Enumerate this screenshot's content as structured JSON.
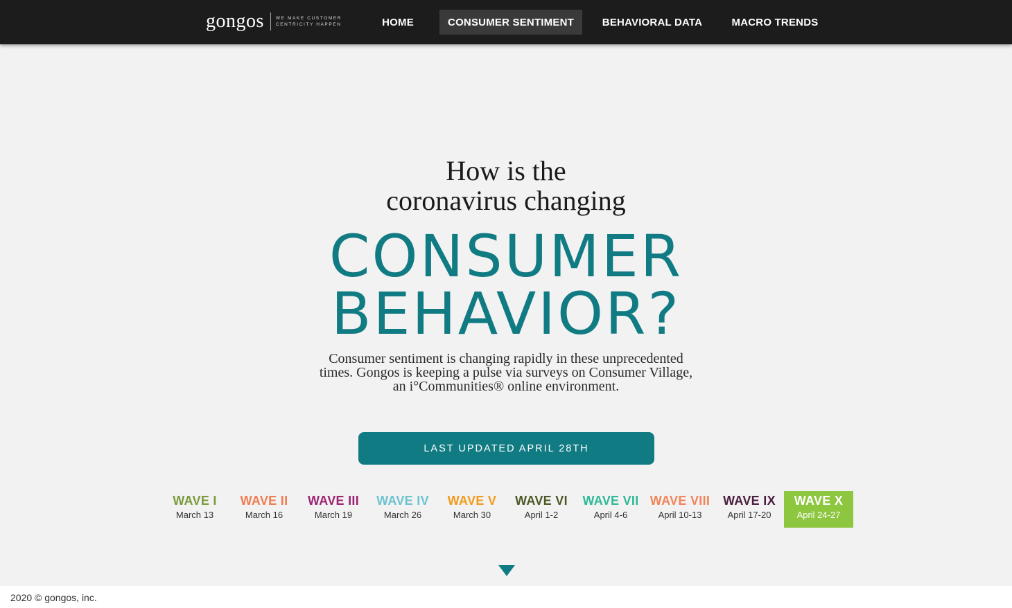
{
  "nav": {
    "logo_text": "gongos",
    "tagline_line1": "WE MAKE CUSTOMER",
    "tagline_line2": "CENTRICITY HAPPEN",
    "items": [
      {
        "label": "HOME"
      },
      {
        "label": "CONSUMER SENTIMENT"
      },
      {
        "label": "BEHAVIORAL DATA"
      },
      {
        "label": "MACRO TRENDS"
      }
    ],
    "active": "CONSUMER SENTIMENT"
  },
  "hero": {
    "line1": "How is the",
    "line2": "coronavirus changing",
    "big1": "CONSUMER",
    "big2": "BEHAVIOR?",
    "desc_line1": "Consumer sentiment is changing rapidly in these unprecedented",
    "desc_line2": "times. Gongos is keeping a pulse via surveys on Consumer Village,",
    "desc_line3": "an i°Communities® online environment.",
    "button_label": "LAST UPDATED APRIL 28TH"
  },
  "waves": [
    {
      "title": "WAVE I",
      "date": "March 13",
      "color": "#7a9a3a"
    },
    {
      "title": "WAVE II",
      "date": "March 16",
      "color": "#f07c52"
    },
    {
      "title": "WAVE III",
      "date": "March 19",
      "color": "#9c2473"
    },
    {
      "title": "WAVE IV",
      "date": "March 26",
      "color": "#6cc3cf"
    },
    {
      "title": "WAVE V",
      "date": "March 30",
      "color": "#f39a1b"
    },
    {
      "title": "WAVE VI",
      "date": "April 1-2",
      "color": "#4d5a26"
    },
    {
      "title": "WAVE VII",
      "date": "April 4-6",
      "color": "#2fb89a"
    },
    {
      "title": "WAVE VIII",
      "date": "April 10-13",
      "color": "#f2845c"
    },
    {
      "title": "WAVE IX",
      "date": "April 17-20",
      "color": "#4a2040"
    },
    {
      "title": "WAVE X",
      "date": "April 24-27",
      "color": "#ffffff",
      "background": "#8dc63f"
    }
  ],
  "colors": {
    "accent": "#107b83",
    "nav_bg": "#1c1c1c",
    "page_bg": "#f2f2f2"
  },
  "arrow_icon": "down-triangle-icon",
  "footer": {
    "text": "2020 © gongos, inc."
  }
}
